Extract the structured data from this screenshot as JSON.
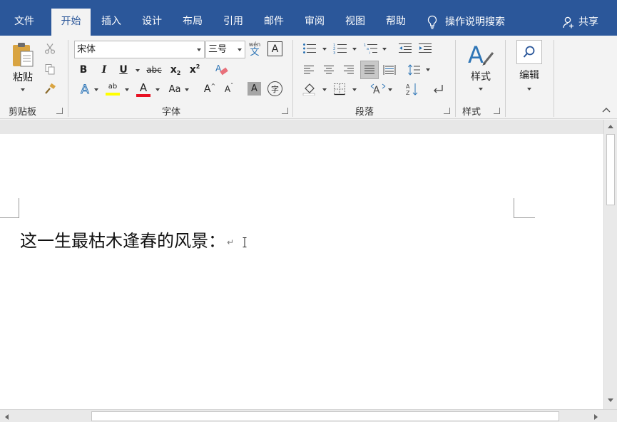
{
  "menu": {
    "tabs": [
      {
        "label": "文件"
      },
      {
        "label": "开始"
      },
      {
        "label": "插入"
      },
      {
        "label": "设计"
      },
      {
        "label": "布局"
      },
      {
        "label": "引用"
      },
      {
        "label": "邮件"
      },
      {
        "label": "审阅"
      },
      {
        "label": "视图"
      },
      {
        "label": "帮助"
      }
    ],
    "active_tab": "开始",
    "tell_me": "操作说明搜索",
    "share": "共享"
  },
  "ribbon": {
    "clipboard": {
      "label": "剪贴板",
      "paste": "粘贴"
    },
    "font": {
      "label": "字体",
      "font_name": "宋体",
      "font_size": "三号",
      "bold": "B",
      "italic": "I",
      "underline": "U",
      "strikethrough": "abc",
      "subscript": "x",
      "subscript_small": "2",
      "superscript": "x",
      "superscript_small": "2",
      "phonetic_top": "wén",
      "phonetic_bottom": "文",
      "char_border": "A",
      "text_effect": "A",
      "highlight": "ab",
      "font_color": "A",
      "change_case": "Aa",
      "grow_font": "A",
      "shrink_font": "A",
      "char_shading": "A",
      "enclose_char": "字"
    },
    "paragraph": {
      "label": "段落"
    },
    "styles": {
      "label": "样式",
      "button": "样式"
    },
    "editing": {
      "button": "编辑"
    }
  },
  "document": {
    "text": "这一生最枯木逢春的风景：",
    "paragraph_mark": "↵"
  },
  "colors": {
    "accent": "#2b579a",
    "highlight_yellow": "#ffff00",
    "font_red": "#e81123",
    "text_effect_blue": "#2e75b6"
  }
}
